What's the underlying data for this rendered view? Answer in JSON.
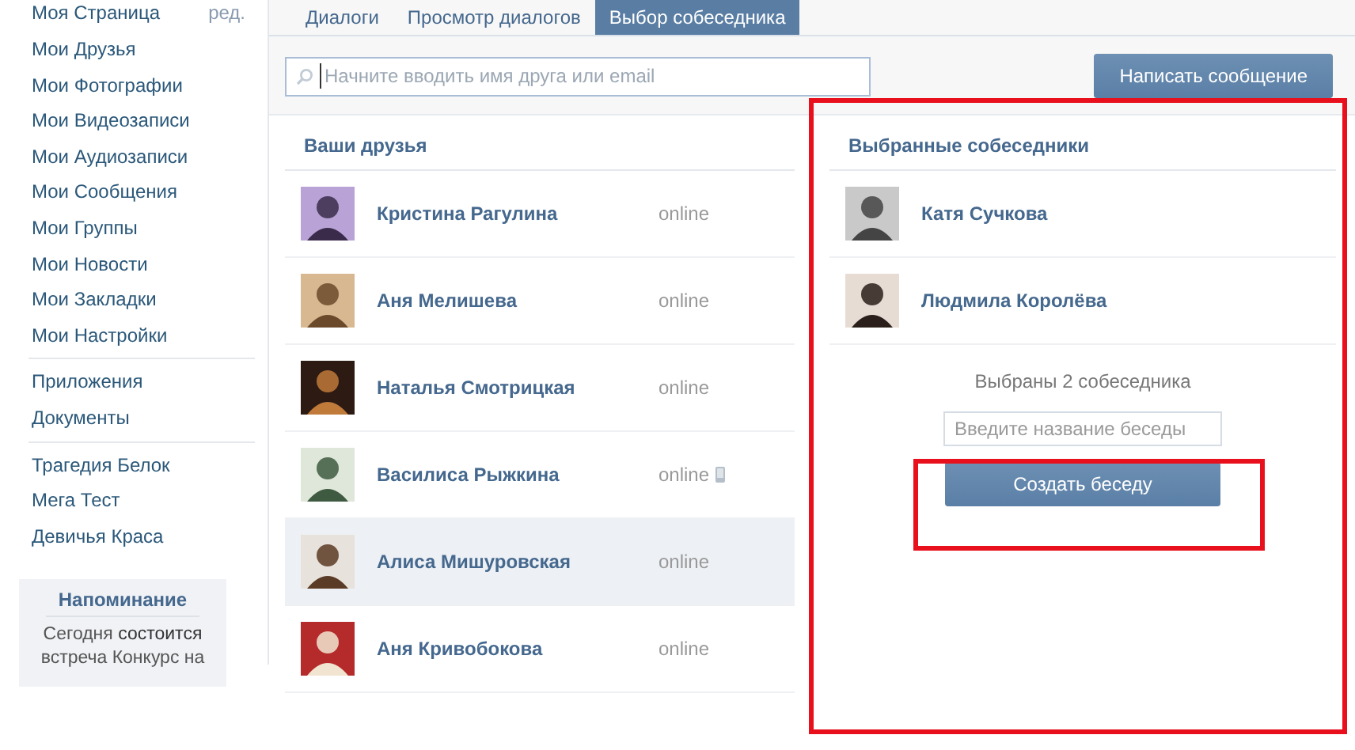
{
  "sidebar": {
    "top_item": {
      "label": "Моя Страница",
      "edit_link": "ред."
    },
    "sections": [
      [
        "Мои Друзья",
        "Мои Фотографии",
        "Мои Видеозаписи",
        "Мои Аудиозаписи",
        "Мои Сообщения",
        "Мои Группы",
        "Мои Новости",
        "Мои Закладки",
        "Мои Настройки"
      ],
      [
        "Приложения",
        "Документы"
      ],
      [
        "Трагедия Белок",
        "Мега Тест",
        "Девичья Краса"
      ]
    ],
    "reminder": {
      "title": "Напоминание",
      "text": "Сегодня **состоится** встреча Конкурс на"
    }
  },
  "tabs": [
    {
      "label": "Диалоги",
      "selected": false
    },
    {
      "label": "Просмотр диалогов",
      "selected": false
    },
    {
      "label": "Выбор собеседника",
      "selected": true
    }
  ],
  "search": {
    "placeholder": "Начните вводить имя друга или email"
  },
  "write_button": "Написать сообщение",
  "friends": {
    "title": "Ваши друзья",
    "items": [
      {
        "name": "Кристина Рагулина",
        "status": "online",
        "mobile": false,
        "highlighted": false
      },
      {
        "name": "Аня Мелишева",
        "status": "online",
        "mobile": false,
        "highlighted": false
      },
      {
        "name": "Наталья Смотрицкая",
        "status": "online",
        "mobile": false,
        "highlighted": false
      },
      {
        "name": "Василиса Рыжкина",
        "status": "online",
        "mobile": true,
        "highlighted": false
      },
      {
        "name": "Алиса Мишуровская",
        "status": "online",
        "mobile": false,
        "highlighted": true
      },
      {
        "name": "Аня Кривобокова",
        "status": "online",
        "mobile": false,
        "highlighted": false
      }
    ]
  },
  "chosen": {
    "title": "Выбранные собеседники",
    "items": [
      {
        "name": "Катя Сучкова"
      },
      {
        "name": "Людмила Королёва"
      }
    ],
    "summary": "Выбраны 2 собеседника",
    "name_field": {
      "placeholder": "Введите название беседы"
    },
    "create_button": "Создать беседу"
  }
}
